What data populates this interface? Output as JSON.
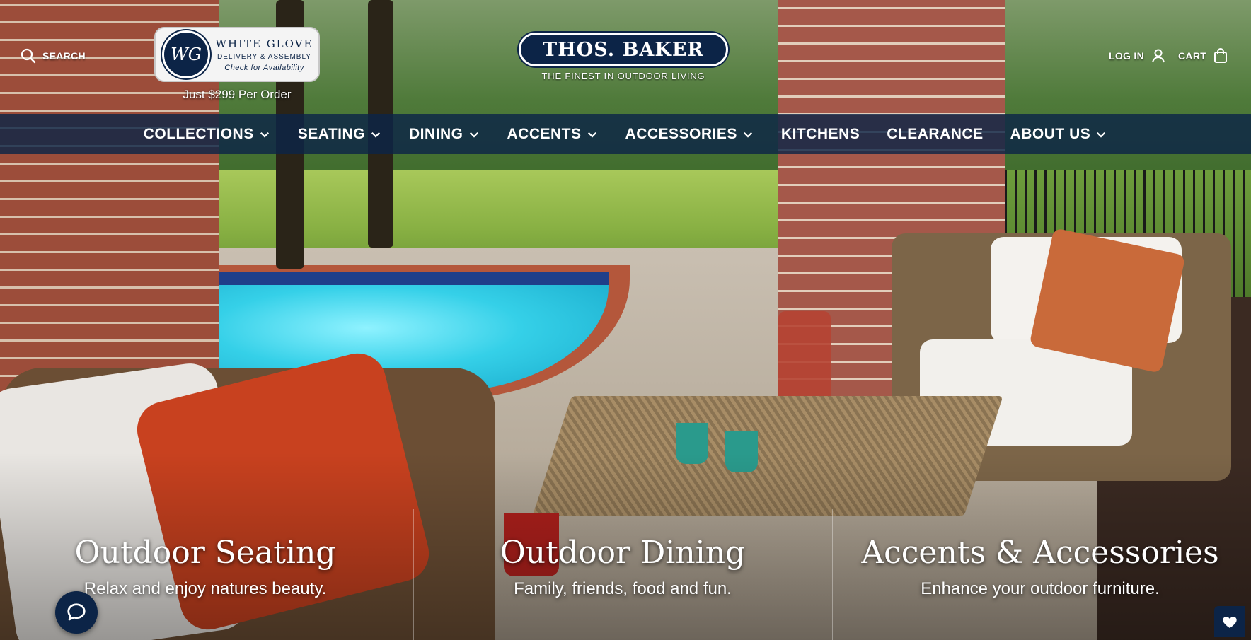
{
  "header": {
    "search_label": "SEARCH",
    "login_label": "LOG IN",
    "cart_label": "CART",
    "brand_name": "THOS. BAKER",
    "brand_tagline": "THE FINEST IN OUTDOOR LIVING"
  },
  "white_glove": {
    "logo_monogram": "WG",
    "title": "WHITE GLOVE",
    "subtitle": "DELIVERY & ASSEMBLY",
    "cta": "Check for Availability",
    "price_note": "Just $299 Per Order"
  },
  "nav": {
    "items": [
      {
        "label": "COLLECTIONS",
        "has_dropdown": true
      },
      {
        "label": "SEATING",
        "has_dropdown": true
      },
      {
        "label": "DINING",
        "has_dropdown": true
      },
      {
        "label": "ACCENTS",
        "has_dropdown": true
      },
      {
        "label": "ACCESSORIES",
        "has_dropdown": true
      },
      {
        "label": "KITCHENS",
        "has_dropdown": false
      },
      {
        "label": "CLEARANCE",
        "has_dropdown": false
      },
      {
        "label": "ABOUT US",
        "has_dropdown": true
      }
    ]
  },
  "tiles": [
    {
      "title": "Outdoor Seating",
      "subtitle": "Relax and enjoy natures beauty."
    },
    {
      "title": "Outdoor Dining",
      "subtitle": "Family, friends, food and fun."
    },
    {
      "title": "Accents & Accessories",
      "subtitle": "Enhance your outdoor furniture."
    }
  ],
  "widgets": {
    "chat_icon": "chat-bubble-icon",
    "wishlist_icon": "heart-icon"
  },
  "colors": {
    "brand_navy": "#0c2447",
    "nav_overlay": "rgba(12,36,71,0.82)",
    "text_on_image": "#ffffff"
  }
}
